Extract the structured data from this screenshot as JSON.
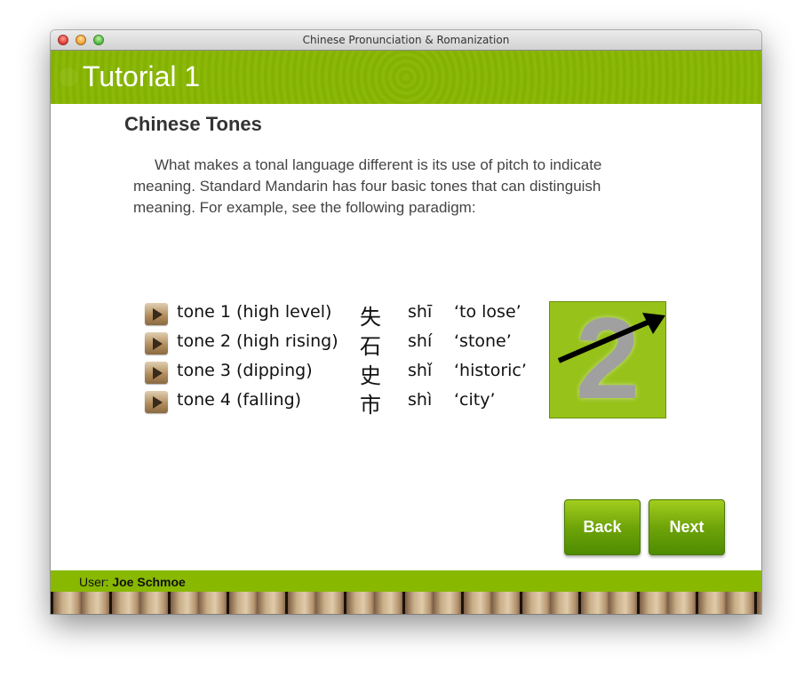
{
  "window": {
    "title": "Chinese Pronunciation & Romanization"
  },
  "header": {
    "title": "Tutorial 1"
  },
  "content": {
    "section_title": "Chinese Tones",
    "intro": "What makes a tonal language different is its use of pitch to indicate meaning.  Standard Mandarin has four basic tones that can distinguish meaning. For example, see the following paradigm:",
    "tones": [
      {
        "label": "tone 1 (high level)",
        "character": "失",
        "pinyin": "shī",
        "gloss": "‘to lose’"
      },
      {
        "label": "tone 2 (high rising)",
        "character": "石",
        "pinyin": "shí",
        "gloss": "‘stone’"
      },
      {
        "label": "tone 3 (dipping)",
        "character": "史",
        "pinyin": "shǐ",
        "gloss": "‘historic’"
      },
      {
        "label": "tone 4 (falling)",
        "character": "市",
        "pinyin": "shì",
        "gloss": "‘city’"
      }
    ],
    "tone_graphic": {
      "digit": "2",
      "arrow": "rising-arrow-icon"
    }
  },
  "navigation": {
    "back_label": "Back",
    "next_label": "Next"
  },
  "footer": {
    "user_prefix": "User:",
    "user_name": "Joe Schmoe"
  },
  "colors": {
    "brand_green": "#87b500",
    "graphic_green": "#97c21a"
  }
}
